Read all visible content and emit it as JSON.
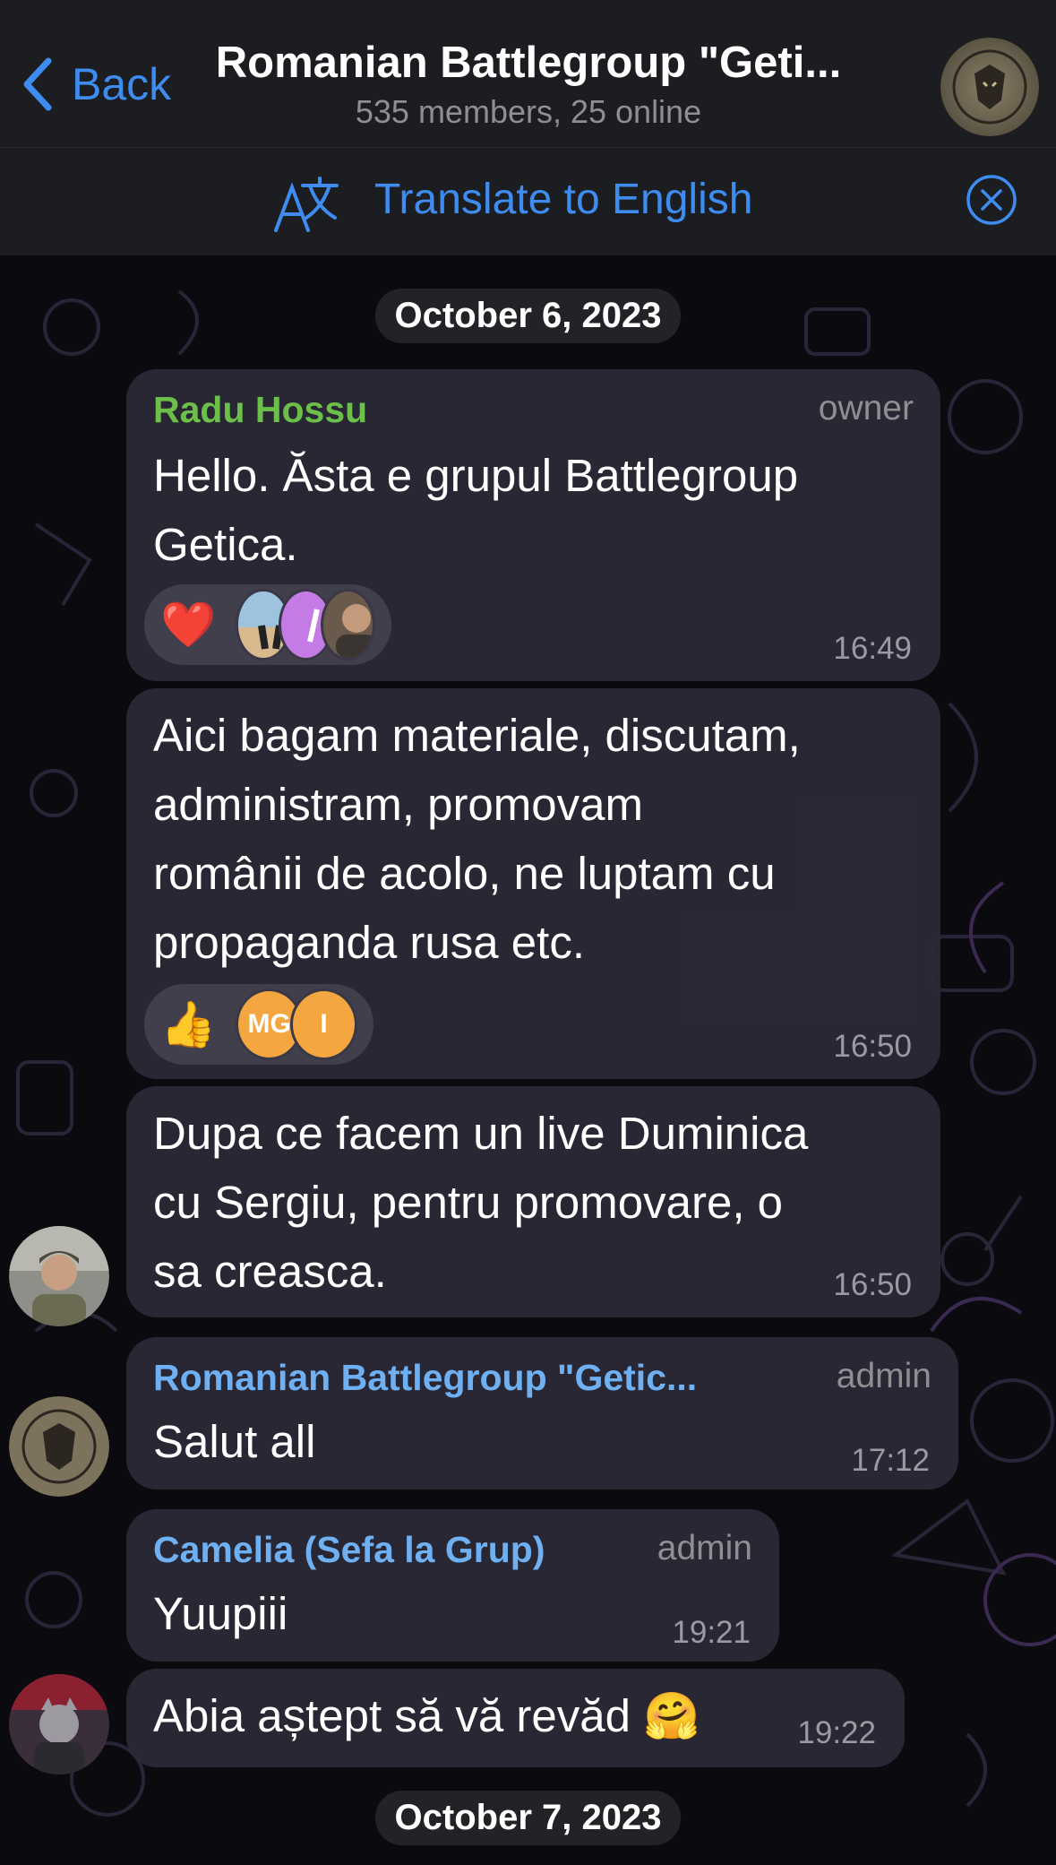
{
  "header": {
    "back_label": "Back",
    "title": "Romanian Battlegroup \"Geti...",
    "subtitle": "535 members, 25 online"
  },
  "translate_bar": {
    "label": "Translate to English"
  },
  "dates": [
    "October 6, 2023",
    "October 7, 2023"
  ],
  "messages": [
    {
      "sender": "Radu Hossu",
      "role": "owner",
      "text_lines": [
        "Hello. Ăsta e grupul Battlegroup",
        "Getica."
      ],
      "time": "16:49",
      "reactions": {
        "emoji": "❤️"
      }
    },
    {
      "text_lines": [
        "Aici bagam materiale, discutam,",
        "administram, promovam",
        "românii de acolo, ne luptam cu",
        "propaganda rusa etc."
      ],
      "time": "16:50",
      "reactions": {
        "emoji": "👍",
        "avatar_initials": [
          "MG",
          "I"
        ]
      }
    },
    {
      "text_lines": [
        "Dupa ce facem un live Duminica",
        "cu Sergiu, pentru promovare, o",
        "sa creasca."
      ],
      "time": "16:50"
    },
    {
      "sender": "Romanian Battlegroup \"Getic...",
      "role": "admin",
      "text_lines": [
        "Salut all"
      ],
      "time": "17:12"
    },
    {
      "sender": "Camelia (Sefa la Grup)",
      "role": "admin",
      "text_lines": [
        "Yuupiii"
      ],
      "time": "19:21"
    },
    {
      "text_lines": [
        "Abia aștept să vă revăd 🤗"
      ],
      "time": "19:22"
    }
  ],
  "colors": {
    "accent": "#3e8cf0",
    "owner_name": "#6cc04a",
    "admin_name": "#6fb0f2"
  }
}
